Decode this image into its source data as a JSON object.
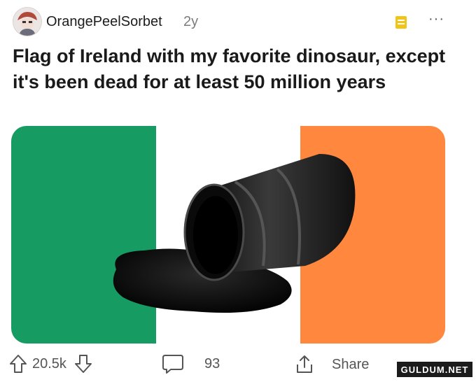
{
  "post": {
    "username": "OrangePeelSorbet",
    "age": "2y",
    "more_label": "···",
    "title": "Flag of Ireland with my favorite dinosaur, except it's been dead for at least 50 million years"
  },
  "flag": {
    "colors": [
      "#169b62",
      "#ffffff",
      "#ff883e"
    ]
  },
  "actions": {
    "upvotes": "20.5k",
    "comments": "93",
    "share_label": "Share"
  },
  "watermark": "GULDUM.NET"
}
